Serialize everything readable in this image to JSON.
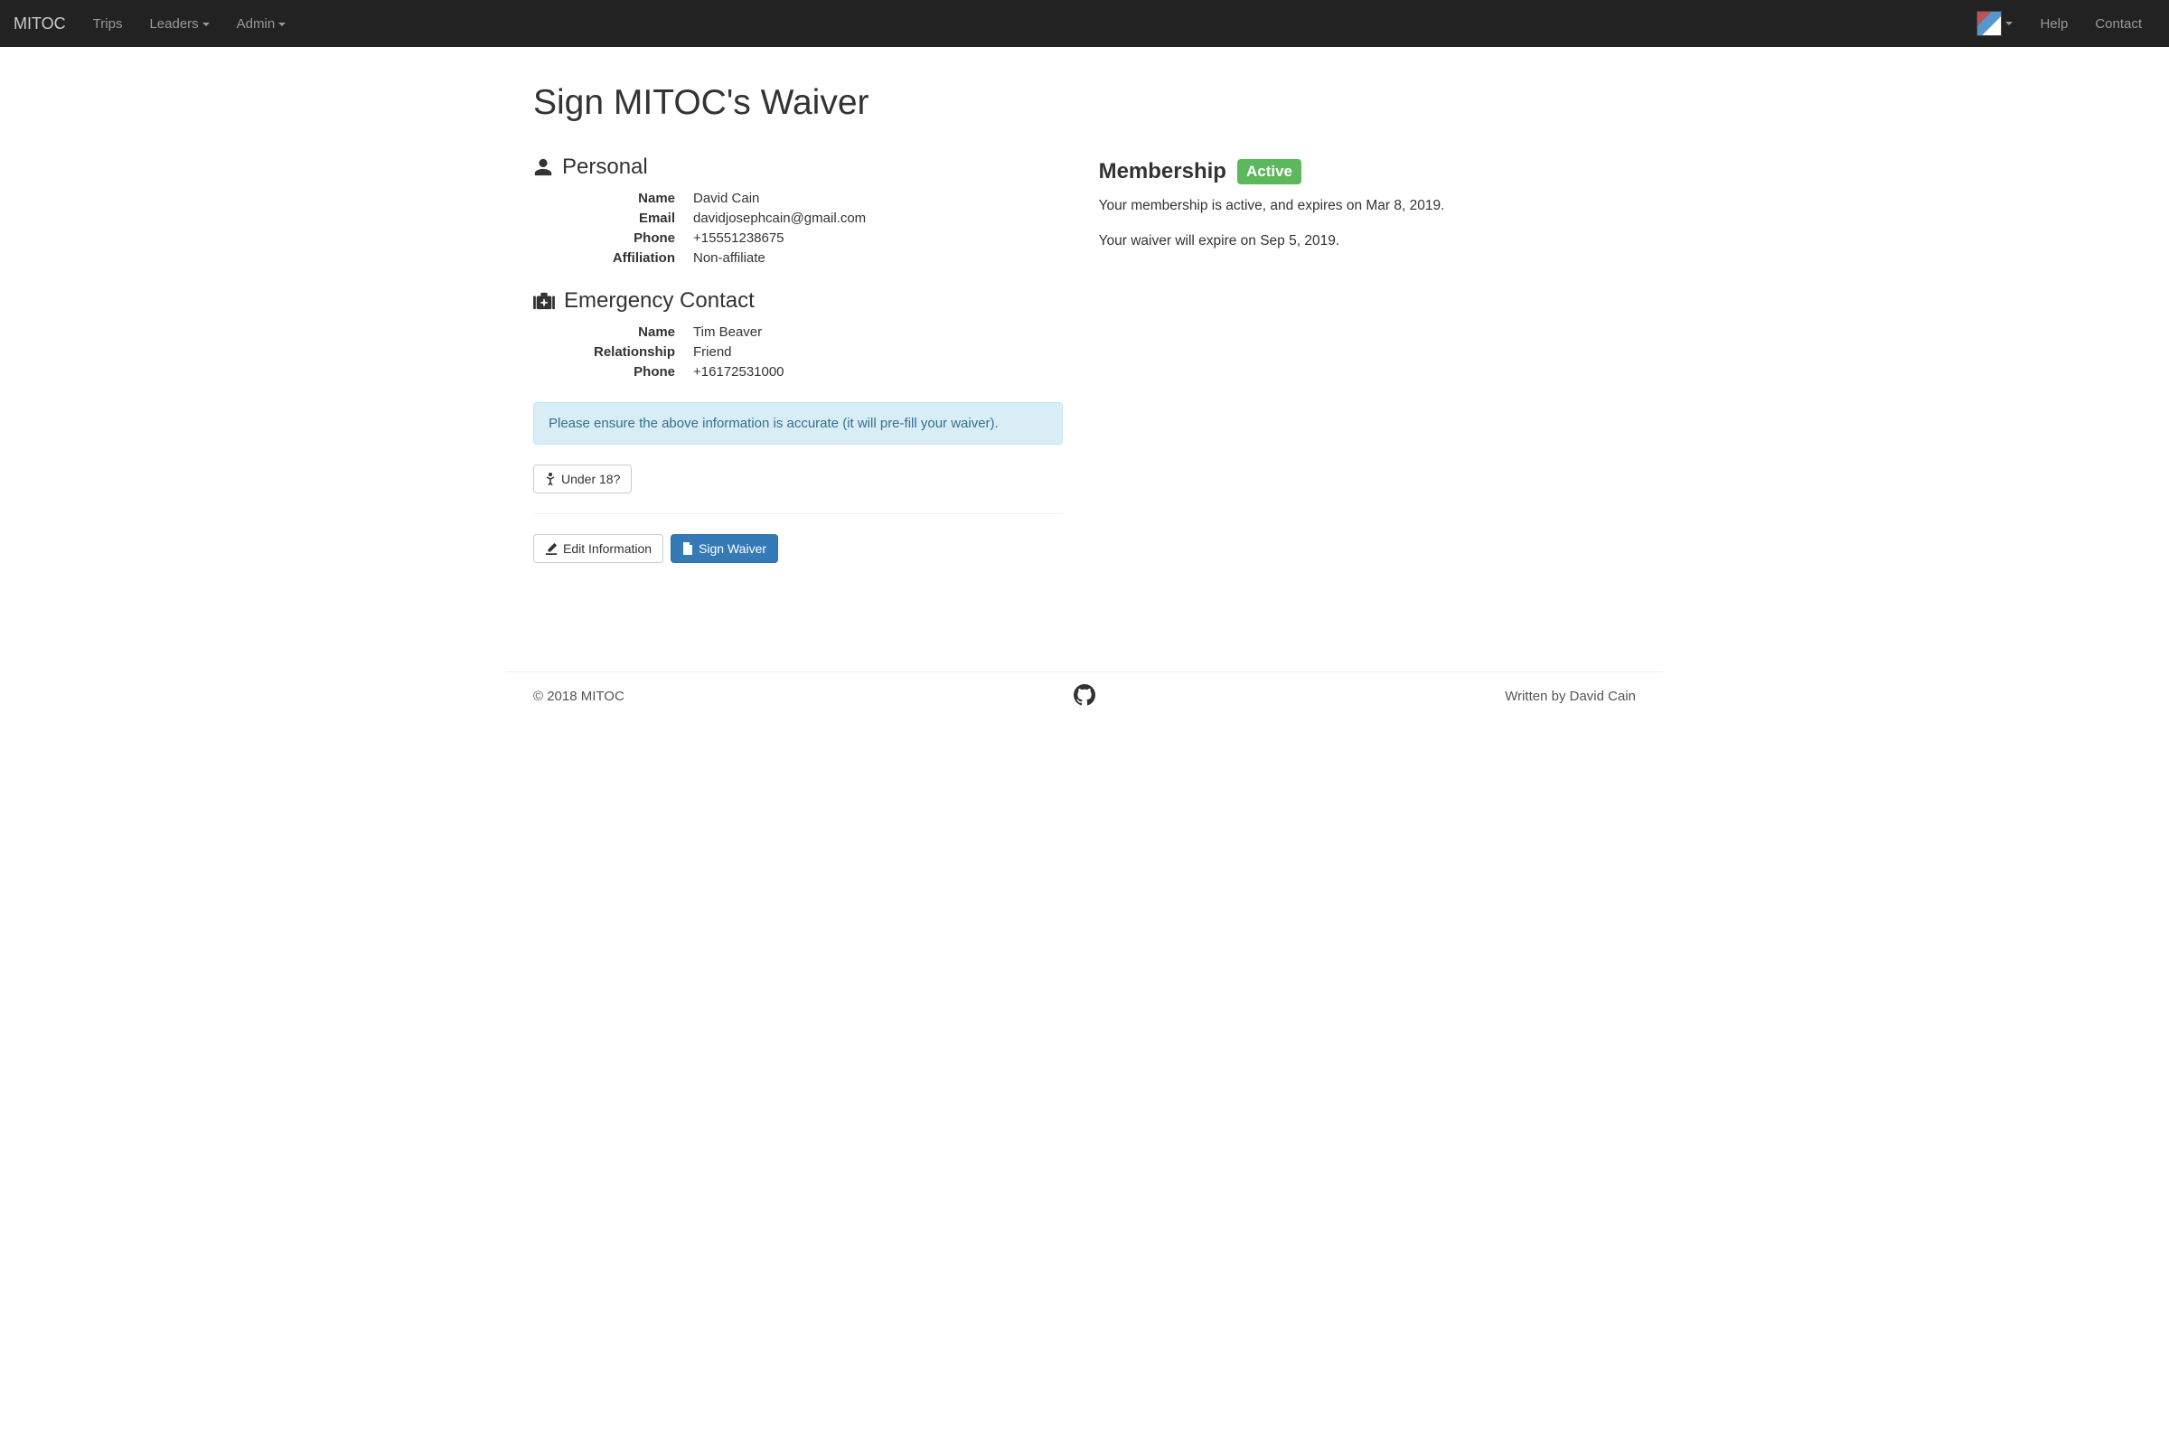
{
  "nav": {
    "brand": "MITOC",
    "trips": "Trips",
    "leaders": "Leaders",
    "admin": "Admin",
    "help": "Help",
    "contact": "Contact"
  },
  "page": {
    "title": "Sign MITOC's Waiver"
  },
  "personal": {
    "heading": "Personal",
    "labels": {
      "name": "Name",
      "email": "Email",
      "phone": "Phone",
      "affiliation": "Affiliation"
    },
    "name": "David Cain",
    "email": "davidjosephcain@gmail.com",
    "phone": "+15551238675",
    "affiliation": "Non-affiliate"
  },
  "emergency": {
    "heading": "Emergency Contact",
    "labels": {
      "name": "Name",
      "relationship": "Relationship",
      "phone": "Phone"
    },
    "name": "Tim Beaver",
    "relationship": "Friend",
    "phone": "+16172531000"
  },
  "alert": "Please ensure the above information is accurate (it will pre-fill your waiver).",
  "buttons": {
    "under18": "Under 18?",
    "edit": "Edit Information",
    "sign": "Sign Waiver"
  },
  "membership": {
    "heading": "Membership",
    "status": "Active",
    "line1": "Your membership is active, and expires on Mar 8, 2019.",
    "line2": "Your waiver will expire on Sep 5, 2019."
  },
  "footer": {
    "copyright": "© 2018 MITOC",
    "credit": "Written by David Cain"
  }
}
